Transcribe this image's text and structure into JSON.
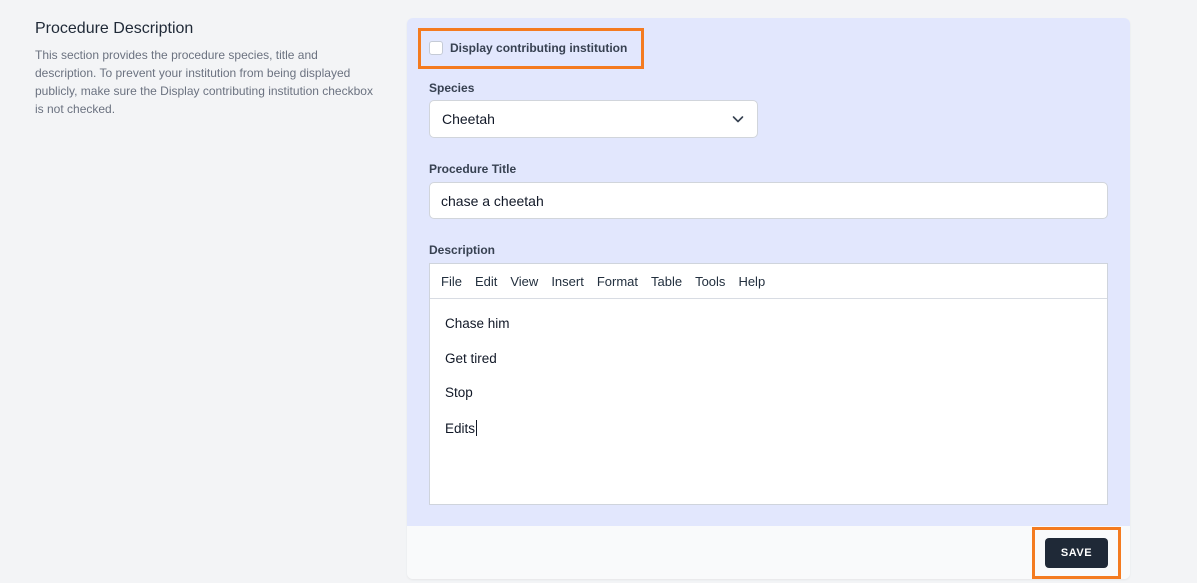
{
  "section": {
    "title": "Procedure Description",
    "description": "This section provides the procedure species, title and description. To prevent your institution from being displayed publicly, make sure the Display contributing institution checkbox is not checked."
  },
  "form": {
    "display_institution_label": "Display contributing institution",
    "display_institution_checked": false,
    "species_label": "Species",
    "species_value": "Cheetah",
    "title_label": "Procedure Title",
    "title_value": "chase a cheetah",
    "description_label": "Description",
    "editor_menu": [
      "File",
      "Edit",
      "View",
      "Insert",
      "Format",
      "Table",
      "Tools",
      "Help"
    ],
    "description_lines": [
      "Chase him",
      "Get tired",
      "Stop",
      "Edits"
    ]
  },
  "footer": {
    "save_label": "SAVE"
  },
  "colors": {
    "highlight": "#f47b20",
    "card_bg": "#e2e7fd",
    "button_bg": "#1f2937"
  },
  "icons": {
    "select_arrow": "chevron-down-icon"
  }
}
